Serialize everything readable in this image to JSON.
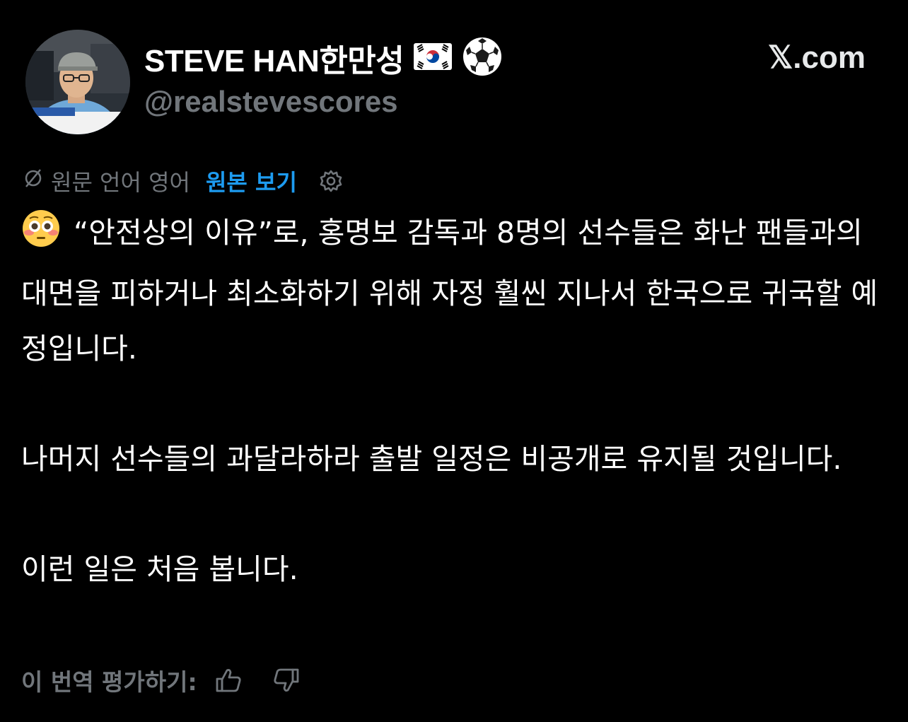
{
  "header": {
    "display_name": "STEVE HAN한만성",
    "name_emoji": [
      "korea-flag",
      "soccer-ball"
    ],
    "handle": "@realstevescores",
    "brand": "𝕏.com"
  },
  "translation": {
    "language_note": "원문 언어 영어",
    "show_original_label": "원본 보기"
  },
  "tweet": {
    "emoji": "flushed-face",
    "paragraph_1": "“안전상의 이유”로, 홍명보 감독과 8명의 선수들은 화난 팬들과의 대면을 피하거나 최소화하기 위해 자정 훨씬 지나서 한국으로 귀국할 예정입니다.",
    "paragraph_2": "나머지 선수들의 과달라하라 출발 일정은 비공개로 유지될 것입니다.",
    "paragraph_3": "이런 일은 처음 봅니다."
  },
  "rating": {
    "label": "이 번역 평가하기:"
  },
  "colors": {
    "background": "#000000",
    "text_primary": "#ffffff",
    "text_secondary": "#71767b",
    "link": "#1d9bf0"
  }
}
